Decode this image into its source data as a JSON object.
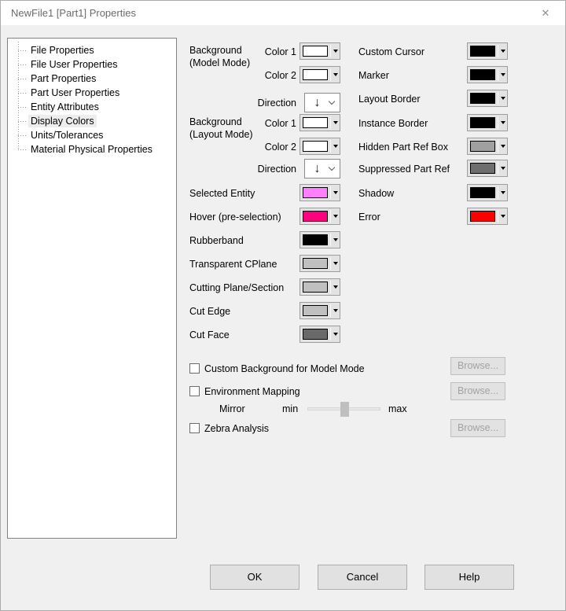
{
  "window": {
    "title": "NewFile1 [Part1] Properties",
    "close_glyph": "✕"
  },
  "tree": {
    "items": [
      {
        "label": "File Properties",
        "selected": false
      },
      {
        "label": "File User Properties",
        "selected": false
      },
      {
        "label": "Part Properties",
        "selected": false
      },
      {
        "label": "Part User Properties",
        "selected": false
      },
      {
        "label": "Entity Attributes",
        "selected": false
      },
      {
        "label": "Display Colors",
        "selected": true
      },
      {
        "label": "Units/Tolerances",
        "selected": false
      },
      {
        "label": "Material Physical Properties",
        "selected": false
      }
    ]
  },
  "colors_page": {
    "bg_model": {
      "title_line1": "Background",
      "title_line2": "(Model Mode)",
      "color1_label": "Color 1",
      "color1": "#FFFFFF",
      "color2_label": "Color 2",
      "color2": "#FFFFFF",
      "direction_label": "Direction",
      "direction_glyph": "↓"
    },
    "bg_layout": {
      "title_line1": "Background",
      "title_line2": "(Layout Mode)",
      "color1_label": "Color 1",
      "color1": "#FFFFFF",
      "color2_label": "Color 2",
      "color2": "#FFFFFF",
      "direction_label": "Direction",
      "direction_glyph": "↓"
    },
    "left_rows": [
      {
        "label": "Selected Entity",
        "color": "#FF80FF"
      },
      {
        "label": "Hover (pre-selection)",
        "color": "#FF0080"
      },
      {
        "label": "Rubberband",
        "color": "#000000"
      },
      {
        "label": "Transparent CPlane",
        "color": "#C0C0C0"
      },
      {
        "label": "Cutting Plane/Section",
        "color": "#C0C0C0"
      },
      {
        "label": "Cut Edge",
        "color": "#C0C0C0"
      },
      {
        "label": "Cut Face",
        "color": "#696969"
      }
    ],
    "right_rows": [
      {
        "label": "Custom Cursor",
        "color": "#000000"
      },
      {
        "label": "Marker",
        "color": "#000000"
      },
      {
        "label": "Layout Border",
        "color": "#000000"
      },
      {
        "label": "Instance Border",
        "color": "#000000"
      },
      {
        "label": "Hidden Part Ref Box",
        "color": "#A0A0A0"
      },
      {
        "label": "Suppressed Part Ref",
        "color": "#6E6E6E"
      },
      {
        "label": "Shadow",
        "color": "#000000"
      },
      {
        "label": "Error",
        "color": "#FF0000"
      }
    ],
    "custom_background": {
      "label": "Custom Background for Model Mode",
      "checked": false,
      "browse_label": "Browse..."
    },
    "environment_mapping": {
      "label": "Environment Mapping",
      "checked": false,
      "browse_label": "Browse...",
      "mirror_label": "Mirror",
      "min_label": "min",
      "max_label": "max",
      "slider_value_pct": 50
    },
    "zebra": {
      "label": "Zebra Analysis",
      "checked": false,
      "browse_label": "Browse..."
    }
  },
  "footer": {
    "ok": "OK",
    "cancel": "Cancel",
    "help": "Help"
  }
}
